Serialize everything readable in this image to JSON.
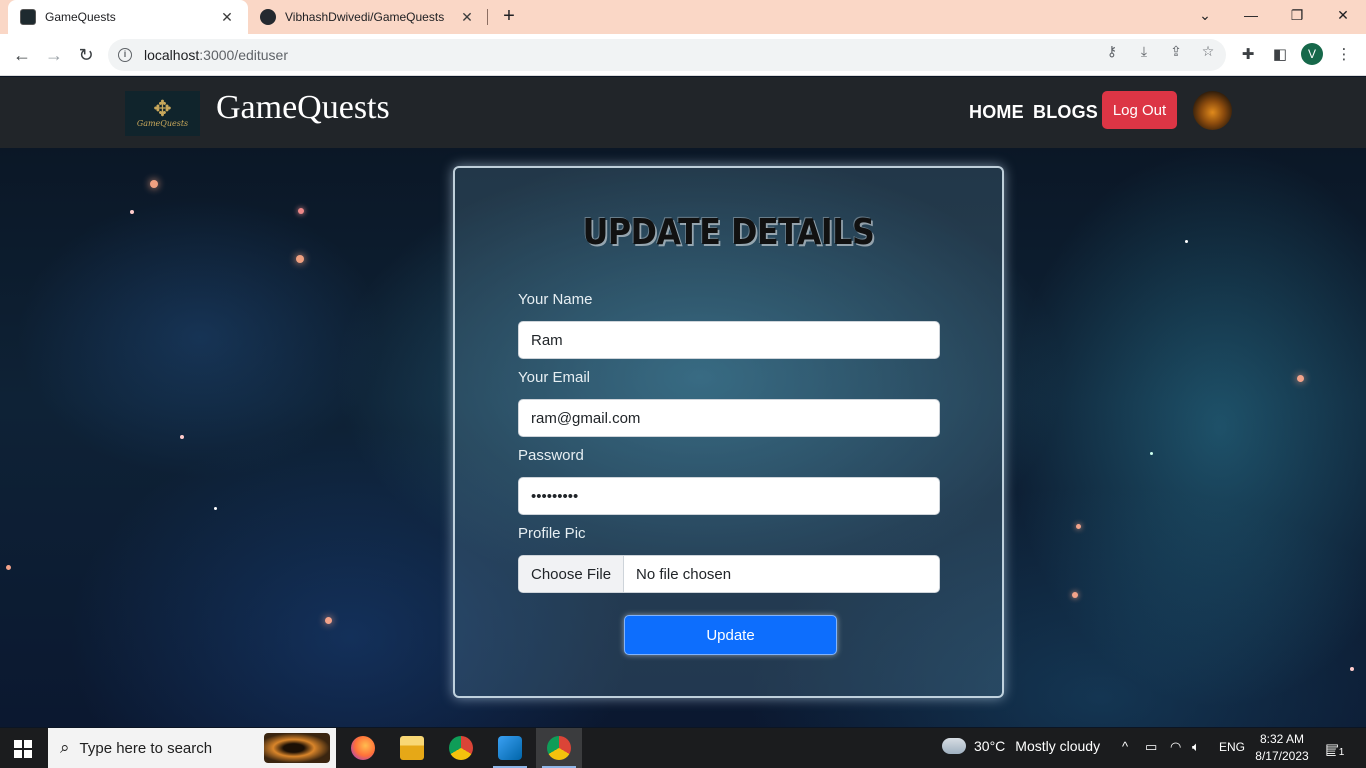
{
  "browser": {
    "tabs": [
      {
        "title": "GameQuests",
        "active": true,
        "icon": "gamequests-favicon"
      },
      {
        "title": "VibhashDwivedi/GameQuests",
        "active": false,
        "icon": "github-icon"
      }
    ],
    "new_tab_label": "+",
    "url_host": "localhost",
    "url_rest": ":3000/edituser",
    "profile_initial": "V"
  },
  "site": {
    "brand": "GameQuests",
    "logo_text": "GameQuests",
    "nav": {
      "home": "HOME",
      "blogs": "BLOGS",
      "logout": "Log Out"
    }
  },
  "form": {
    "title": "UPDATE DETAILS",
    "name_label": "Your Name",
    "name_value": "Ram",
    "email_label": "Your Email",
    "email_value": "ram@gmail.com",
    "password_label": "Password",
    "password_value": "•••••••••",
    "pic_label": "Profile Pic",
    "choose_file": "Choose File",
    "no_file": "No file chosen",
    "submit": "Update"
  },
  "taskbar": {
    "search_placeholder": "Type here to search",
    "weather_temp": "30°C",
    "weather_desc": "Mostly cloudy",
    "language": "ENG",
    "time": "8:32 AM",
    "date": "8/17/2023",
    "notification_count": "1"
  },
  "colors": {
    "tab_strip": "#fad7c6",
    "navbar": "#212529",
    "logout": "#dc3545",
    "primary": "#0d6efd"
  }
}
